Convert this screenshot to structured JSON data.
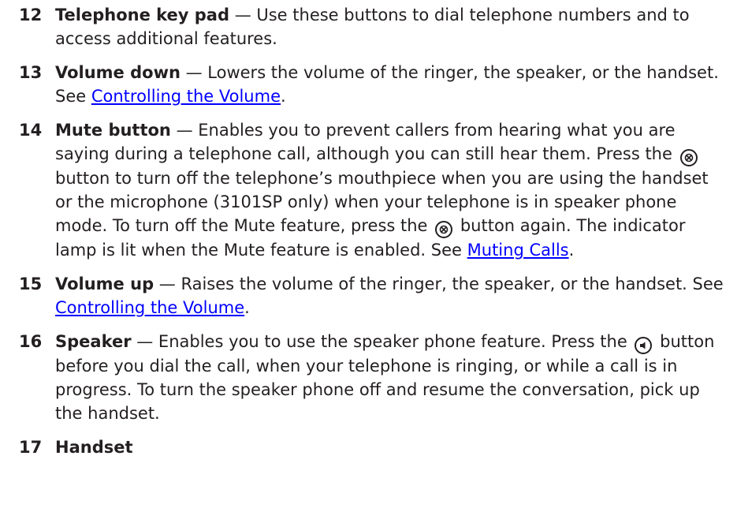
{
  "items": [
    {
      "num": "12",
      "term": "Telephone key pad",
      "text": " — Use these buttons to dial telephone numbers and to access additional features."
    },
    {
      "num": "13",
      "term": "Volume down",
      "text": " — Lowers the volume of the ringer, the speaker, or the handset. See ",
      "link": "Controlling the Volume",
      "tail": "."
    },
    {
      "num": "14",
      "term": "Mute button",
      "text1": " — Enables you to prevent callers from hearing what you are saying during a telephone call, although you can still hear them. Press the ",
      "text2": " button to turn off the telephone’s mouthpiece when you are using the handset or the microphone (3101SP only) when your telephone is in speaker phone mode. To turn off the Mute feature, press the ",
      "text3": " button again. The indicator lamp is lit when the Mute feature is enabled. See ",
      "link": "Muting Calls",
      "tail": "."
    },
    {
      "num": "15",
      "term": "Volume up",
      "text": " — Raises the volume of the ringer, the speaker, or the handset. See ",
      "link": "Controlling the Volume",
      "tail": "."
    },
    {
      "num": "16",
      "term": "Speaker",
      "text1": " — Enables you to use the speaker phone feature. Press the ",
      "text2": " button before you dial the call, when your telephone is ringing, or while a call is in progress. To turn the speaker phone off and resume the conversation, pick up the handset."
    },
    {
      "num": "17",
      "term": "Handset"
    }
  ],
  "icons": {
    "mute": "mute-button-icon",
    "speaker": "speaker-button-icon"
  }
}
